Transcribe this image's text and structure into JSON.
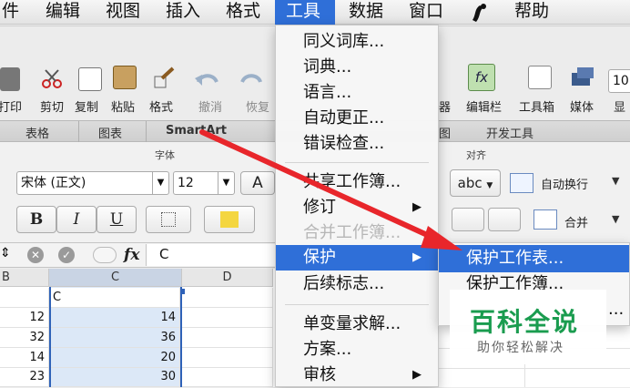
{
  "menubar": {
    "items": [
      "件",
      "编辑",
      "视图",
      "插入",
      "格式",
      "工具",
      "数据",
      "窗口",
      "帮助"
    ],
    "active": "工具"
  },
  "toolbar": {
    "labels": [
      "打印",
      "剪切",
      "复制",
      "粘贴",
      "格式",
      "撤消",
      "恢复",
      "器",
      "编辑栏",
      "工具箱",
      "媒体",
      "显"
    ],
    "zoom_partial": "10"
  },
  "ribbon_tabs": [
    "表格",
    "图表",
    "SmartArt",
    "图",
    "开发工具"
  ],
  "font_group": {
    "title": "字体",
    "font_name": "宋体 (正文)",
    "font_size": "12",
    "grow_font": "A",
    "bold": "B",
    "italic": "I",
    "underline": "U"
  },
  "align_group": {
    "title": "对齐",
    "abc": "abc",
    "wrap_text": "自动换行",
    "merge": "合并"
  },
  "formula_bar": {
    "fx": "fx",
    "content": "C"
  },
  "sheet": {
    "columns": [
      "B",
      "C",
      "D"
    ],
    "header_cell": "C",
    "rows": [
      {
        "b": "12",
        "c": "14"
      },
      {
        "b": "32",
        "c": "36"
      },
      {
        "b": "14",
        "c": "20"
      },
      {
        "b": "23",
        "c": "30"
      }
    ]
  },
  "tools_menu": {
    "items": [
      {
        "label": "同义词库..."
      },
      {
        "label": "词典..."
      },
      {
        "label": "语言..."
      },
      {
        "label": "自动更正..."
      },
      {
        "label": "错误检查..."
      },
      {
        "label": "共享工作簿..."
      },
      {
        "label": "修订"
      },
      {
        "label": "合并工作簿..."
      },
      {
        "label": "保护"
      },
      {
        "label": "后续标志..."
      },
      {
        "label": "单变量求解..."
      },
      {
        "label": "方案..."
      },
      {
        "label": "审核"
      }
    ],
    "submenu_arrow": "▶"
  },
  "protect_submenu": {
    "items": [
      "保护工作表...",
      "保护工作簿..."
    ],
    "more": "..."
  },
  "watermark": {
    "main": "百科全说",
    "sub": "助你轻松解决"
  },
  "colors": {
    "highlight": "#2f6fd8",
    "arrow": "#e8262b",
    "watermark_green": "#1a9c4f",
    "selection": "#dce8f7"
  }
}
